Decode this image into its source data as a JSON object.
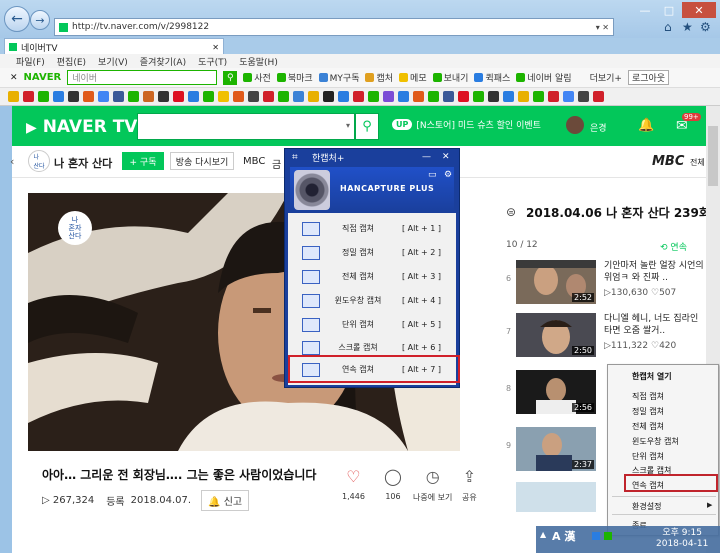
{
  "browser": {
    "url": "http://tv.naver.com/v/2998122",
    "tab_title": "네이버TV",
    "menus": [
      "파일(F)",
      "편집(E)",
      "보기(V)",
      "즐겨찾기(A)",
      "도구(T)",
      "도움말(H)"
    ]
  },
  "naver_toolbar": {
    "brand": "NAVER",
    "search_placeholder": "네이버",
    "items": [
      "사전",
      "북마크",
      "MY구독",
      "캡처",
      "메모",
      "보내기",
      "퀵패스",
      "네이버 알림",
      "더보기+",
      "로그아웃"
    ]
  },
  "tv": {
    "logo": "NAVER TV",
    "up_badge": "UP",
    "promo": "[N스토어] 미드 슈츠 할인 이벤트",
    "user": "은경",
    "notify_count": "99+"
  },
  "channel": {
    "name": "나 혼자 산다",
    "subscribe": "+ 구독",
    "replay": "방송 다시보기",
    "network": "MBC",
    "truncated": "금",
    "mbc_logo": "MBC",
    "mbc_side": "전체"
  },
  "video": {
    "title": "아아… 그리운 전 회장님…. 그는 좋은 사람이었습니다",
    "views": "▷ 267,324",
    "date_label": "등록",
    "date": "2018.04.07.",
    "report": "신고",
    "actions": [
      {
        "icon": "heart",
        "label": "1,446"
      },
      {
        "icon": "comment",
        "label": "106"
      },
      {
        "icon": "clock",
        "label": "나중에 보기"
      },
      {
        "icon": "share",
        "label": "공유"
      }
    ]
  },
  "playlist": {
    "heading": "2018.04.06 나 혼자 산다 239회",
    "count": "10 / 12",
    "continuous": "연속",
    "items": [
      {
        "index": "6",
        "duration": "2:52",
        "title": "기안마저 놀란 얼장 시언의 위엄ㅋ 와 진짜 ..",
        "views": "▷130,630",
        "likes": "♡507"
      },
      {
        "index": "7",
        "duration": "2:50",
        "title": "다니엘 헤니, 너도 집라인 타면 오줌 쌀거..",
        "views": "▷111,322",
        "likes": "♡420"
      },
      {
        "index": "8",
        "duration": "2:56",
        "title": "",
        "views": "",
        "likes": ""
      },
      {
        "index": "9",
        "duration": "2:37",
        "title": "",
        "views": "",
        "likes": ""
      }
    ]
  },
  "hancapture": {
    "title": "한캡처+",
    "brand": "HANCAPTURE PLUS",
    "items": [
      {
        "label": "직접 캡쳐",
        "key": "[ Alt + 1 ]"
      },
      {
        "label": "정밀 캡쳐",
        "key": "[ Alt + 2 ]"
      },
      {
        "label": "전체 캡쳐",
        "key": "[ Alt + 3 ]"
      },
      {
        "label": "윈도우창 캡쳐",
        "key": "[ Alt + 4 ]"
      },
      {
        "label": "단위 캡쳐",
        "key": "[ Alt + 5 ]"
      },
      {
        "label": "스크롤 캡쳐",
        "key": "[ Alt + 6 ]"
      },
      {
        "label": "연속 캡쳐",
        "key": "[ Alt + 7 ]"
      }
    ]
  },
  "context_menu": {
    "items": [
      "한캡처 열기",
      "직접 캡쳐",
      "정밀 캡쳐",
      "전체 캡쳐",
      "윈도우창 캡쳐",
      "단위 캡쳐",
      "스크롤 캡쳐",
      "연속 캡쳐",
      "환경설정",
      "종료"
    ]
  },
  "taskbar": {
    "ime": "A 漢",
    "time": "오후 9:15",
    "date": "2018-04-11"
  },
  "colors": {
    "naver_green": "#03c75a",
    "highlight_red": "#d0202a",
    "hc_blue": "#1a3f9c"
  }
}
